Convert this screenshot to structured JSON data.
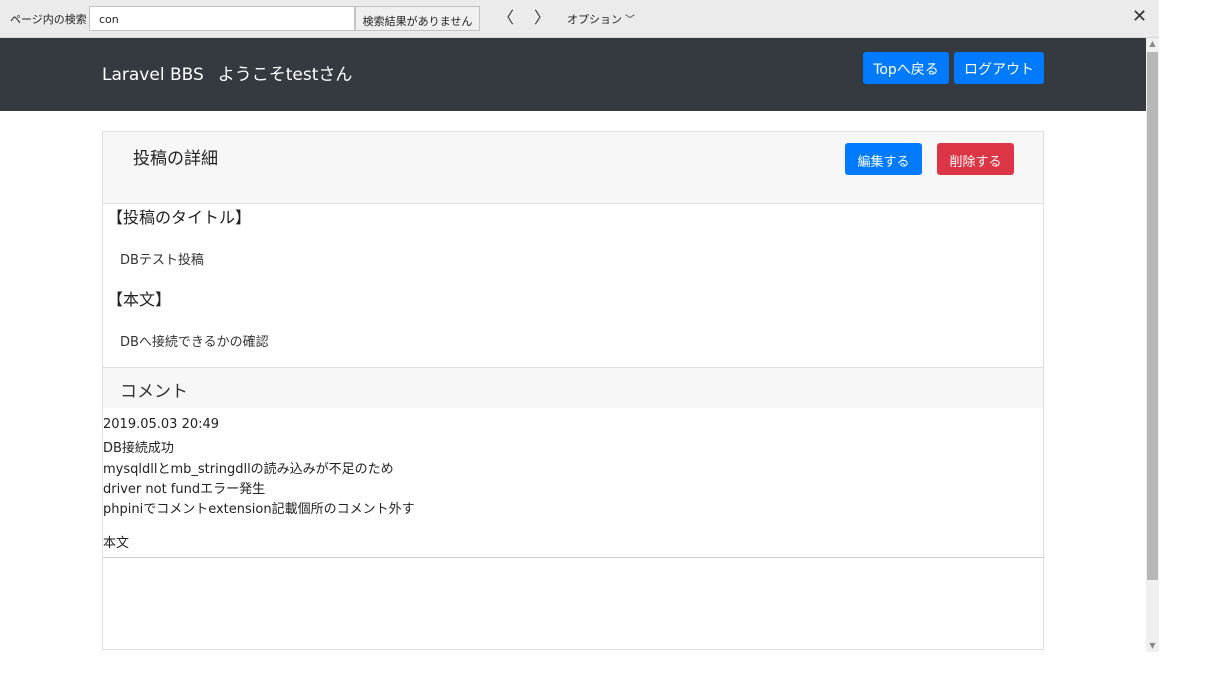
{
  "findbar": {
    "label": "ページ内の検索",
    "query": "con",
    "result": "検索結果がありません",
    "prev": "〈",
    "next": "〉",
    "options": "オプション",
    "close": "✕"
  },
  "navbar": {
    "brand": "Laravel BBS",
    "welcome": "ようこそtestさん",
    "top_button": "Topへ戻る",
    "logout_button": "ログアウト"
  },
  "post": {
    "header": "投稿の詳細",
    "edit_button": "編集する",
    "delete_button": "削除する",
    "title_label": "【投稿のタイトル】",
    "title_value": "DBテスト投稿",
    "body_label": "【本文】",
    "body_value": "DBへ接続できるかの確認"
  },
  "comments": {
    "header": "コメント",
    "lines": [
      "2019.05.03 20:49",
      "DB接続成功",
      "mysqldllとmb_stringdllの読み込みが不足のため",
      "driver not fundエラー発生",
      "phpiniでコメントextension記載個所のコメント外す"
    ],
    "form_label": "本文"
  },
  "colors": {
    "navbar": "#343a40",
    "primary": "#007bff",
    "danger": "#dc3545"
  }
}
